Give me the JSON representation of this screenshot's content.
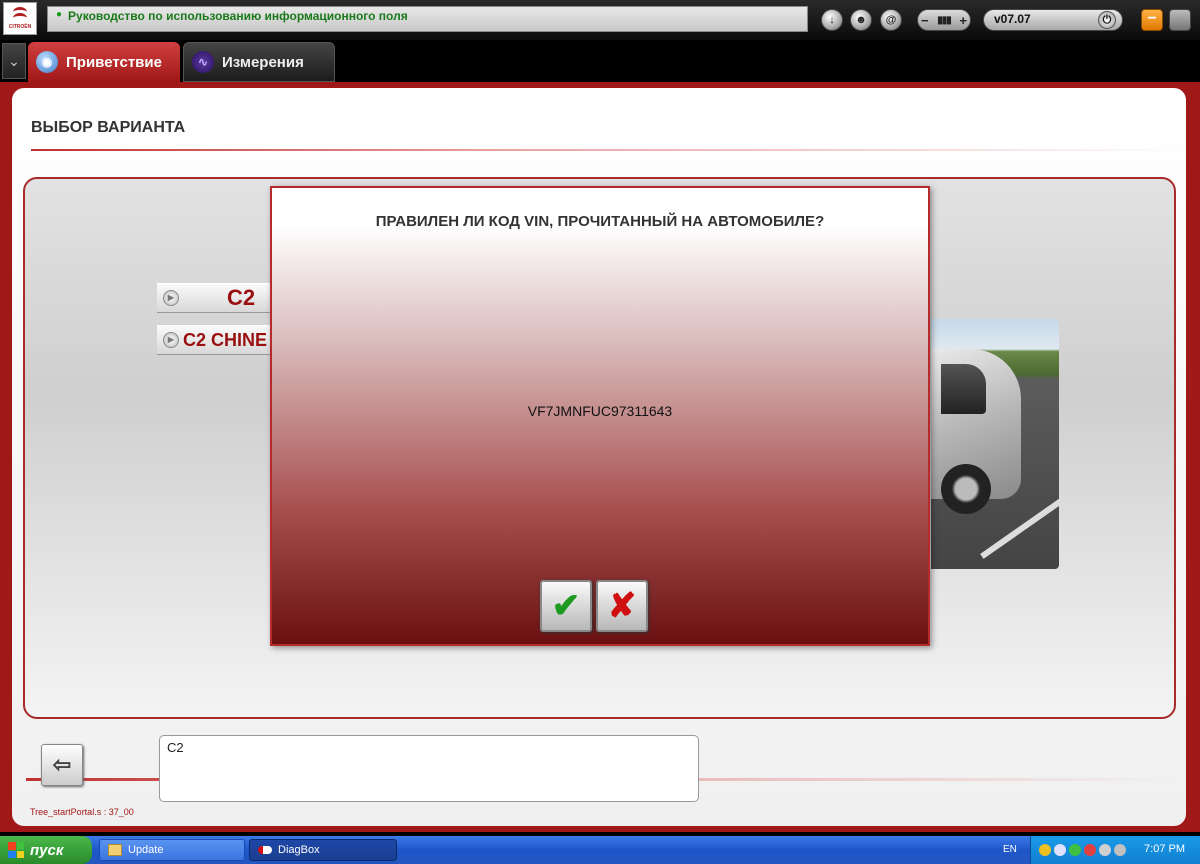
{
  "topbar": {
    "brand": "CITROËN",
    "help_text": "Руководство по использованию информационного поля",
    "version": "v07.07",
    "buttons": [
      "download-icon",
      "person-icon",
      "at-icon"
    ],
    "volume_minus": "−",
    "volume_plus": "+"
  },
  "tabs": [
    {
      "label": "Приветствие",
      "icon": "globe-icon",
      "active": true
    },
    {
      "label": "Измерения",
      "icon": "waveform-icon",
      "active": false
    }
  ],
  "page": {
    "title": "ВЫБОР ВАРИАНТА",
    "options": [
      {
        "label": "C2"
      },
      {
        "label": "C2 CHINE"
      }
    ],
    "selection_text": "C2",
    "status": "Tree_startPortal.s : 37_00"
  },
  "dialog": {
    "question": "ПРАВИЛЕН ЛИ КОД VIN, ПРОЧИТАННЫЙ НА АВТОМОБИЛЕ?",
    "vin": "VF7JMNFUC97311643",
    "confirm_icon": "checkmark-icon",
    "cancel_icon": "x-icon"
  },
  "taskbar": {
    "start": "пуск",
    "tasks": [
      {
        "label": "Update",
        "icon": "folder-icon"
      },
      {
        "label": "DiagBox",
        "icon": "diagbox-icon"
      }
    ],
    "lang": "EN",
    "clock": "7:07 PM"
  },
  "colors": {
    "accent": "#a01818",
    "dialog_border": "#b52a2a",
    "confirm": "#1e9a1e",
    "cancel": "#d01010"
  }
}
